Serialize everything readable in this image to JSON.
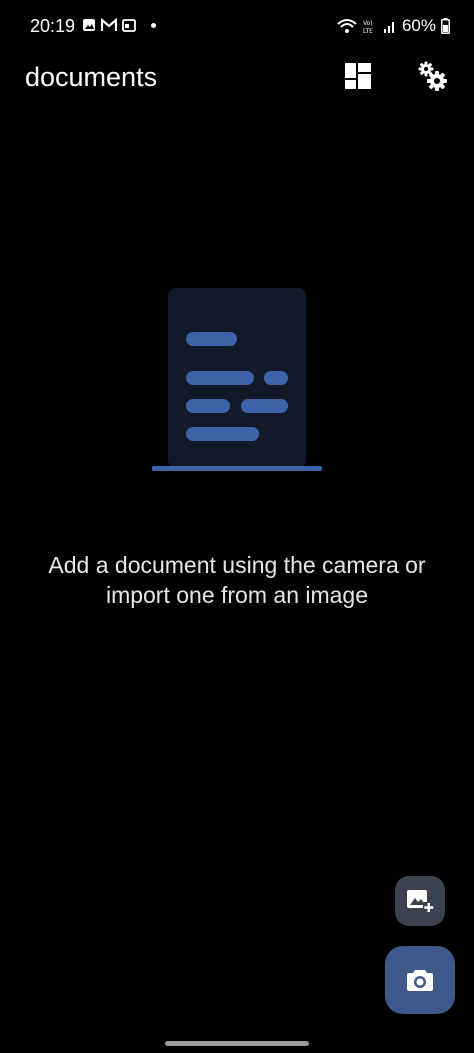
{
  "status_bar": {
    "time": "20:19",
    "battery": "60%",
    "icons": [
      "gallery-icon",
      "gmail-icon",
      "calendar-icon",
      "notification-dot",
      "wifi-6-icon",
      "volte-icon",
      "signal-icon",
      "battery-icon"
    ]
  },
  "app_bar": {
    "title": "documents",
    "actions": [
      "layout-grid-icon",
      "settings-gears-icon"
    ]
  },
  "empty_state": {
    "message": "Add a document using the camera or import one from an image",
    "illustration": "document-illustration"
  },
  "fabs": {
    "import_image": "add-photo-icon",
    "camera": "camera-icon"
  },
  "colors": {
    "background": "#000000",
    "accent": "#3f5a8a",
    "illustration_page": "#121a2a",
    "illustration_lines": "#3d64a8"
  }
}
